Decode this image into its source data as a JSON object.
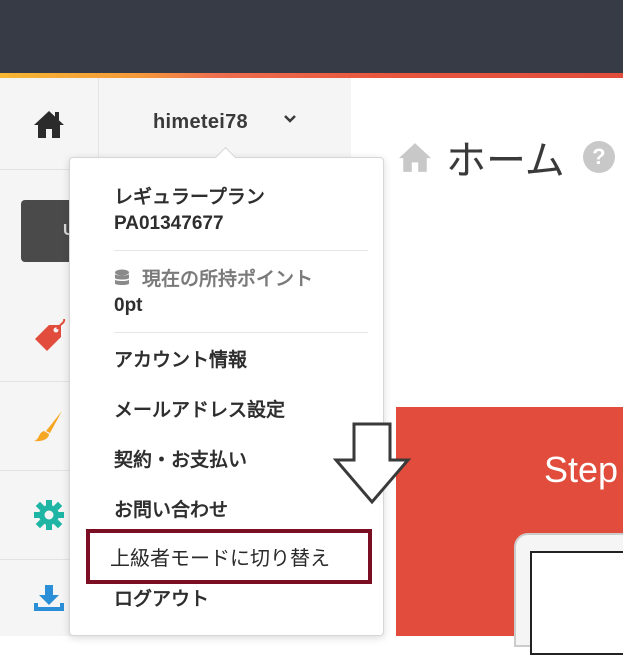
{
  "user": {
    "name": "himetei78"
  },
  "sidebar": {
    "tile_letter": "U"
  },
  "main": {
    "title": "ホーム",
    "help_label": "?",
    "card_text": "Step"
  },
  "dropdown": {
    "plan_name": "レギュラープラン",
    "plan_id": "PA01347677",
    "points_label": "現在の所持ポイント",
    "points_value": "0pt",
    "items": [
      "アカウント情報",
      "メールアドレス設定",
      "契約・お支払い",
      "お問い合わせ",
      "上級者モードに切り替え",
      "ログアウト"
    ]
  },
  "colors": {
    "topbar": "#363b45",
    "accent": "#e14c3c",
    "annotation": "#7b0e23"
  }
}
